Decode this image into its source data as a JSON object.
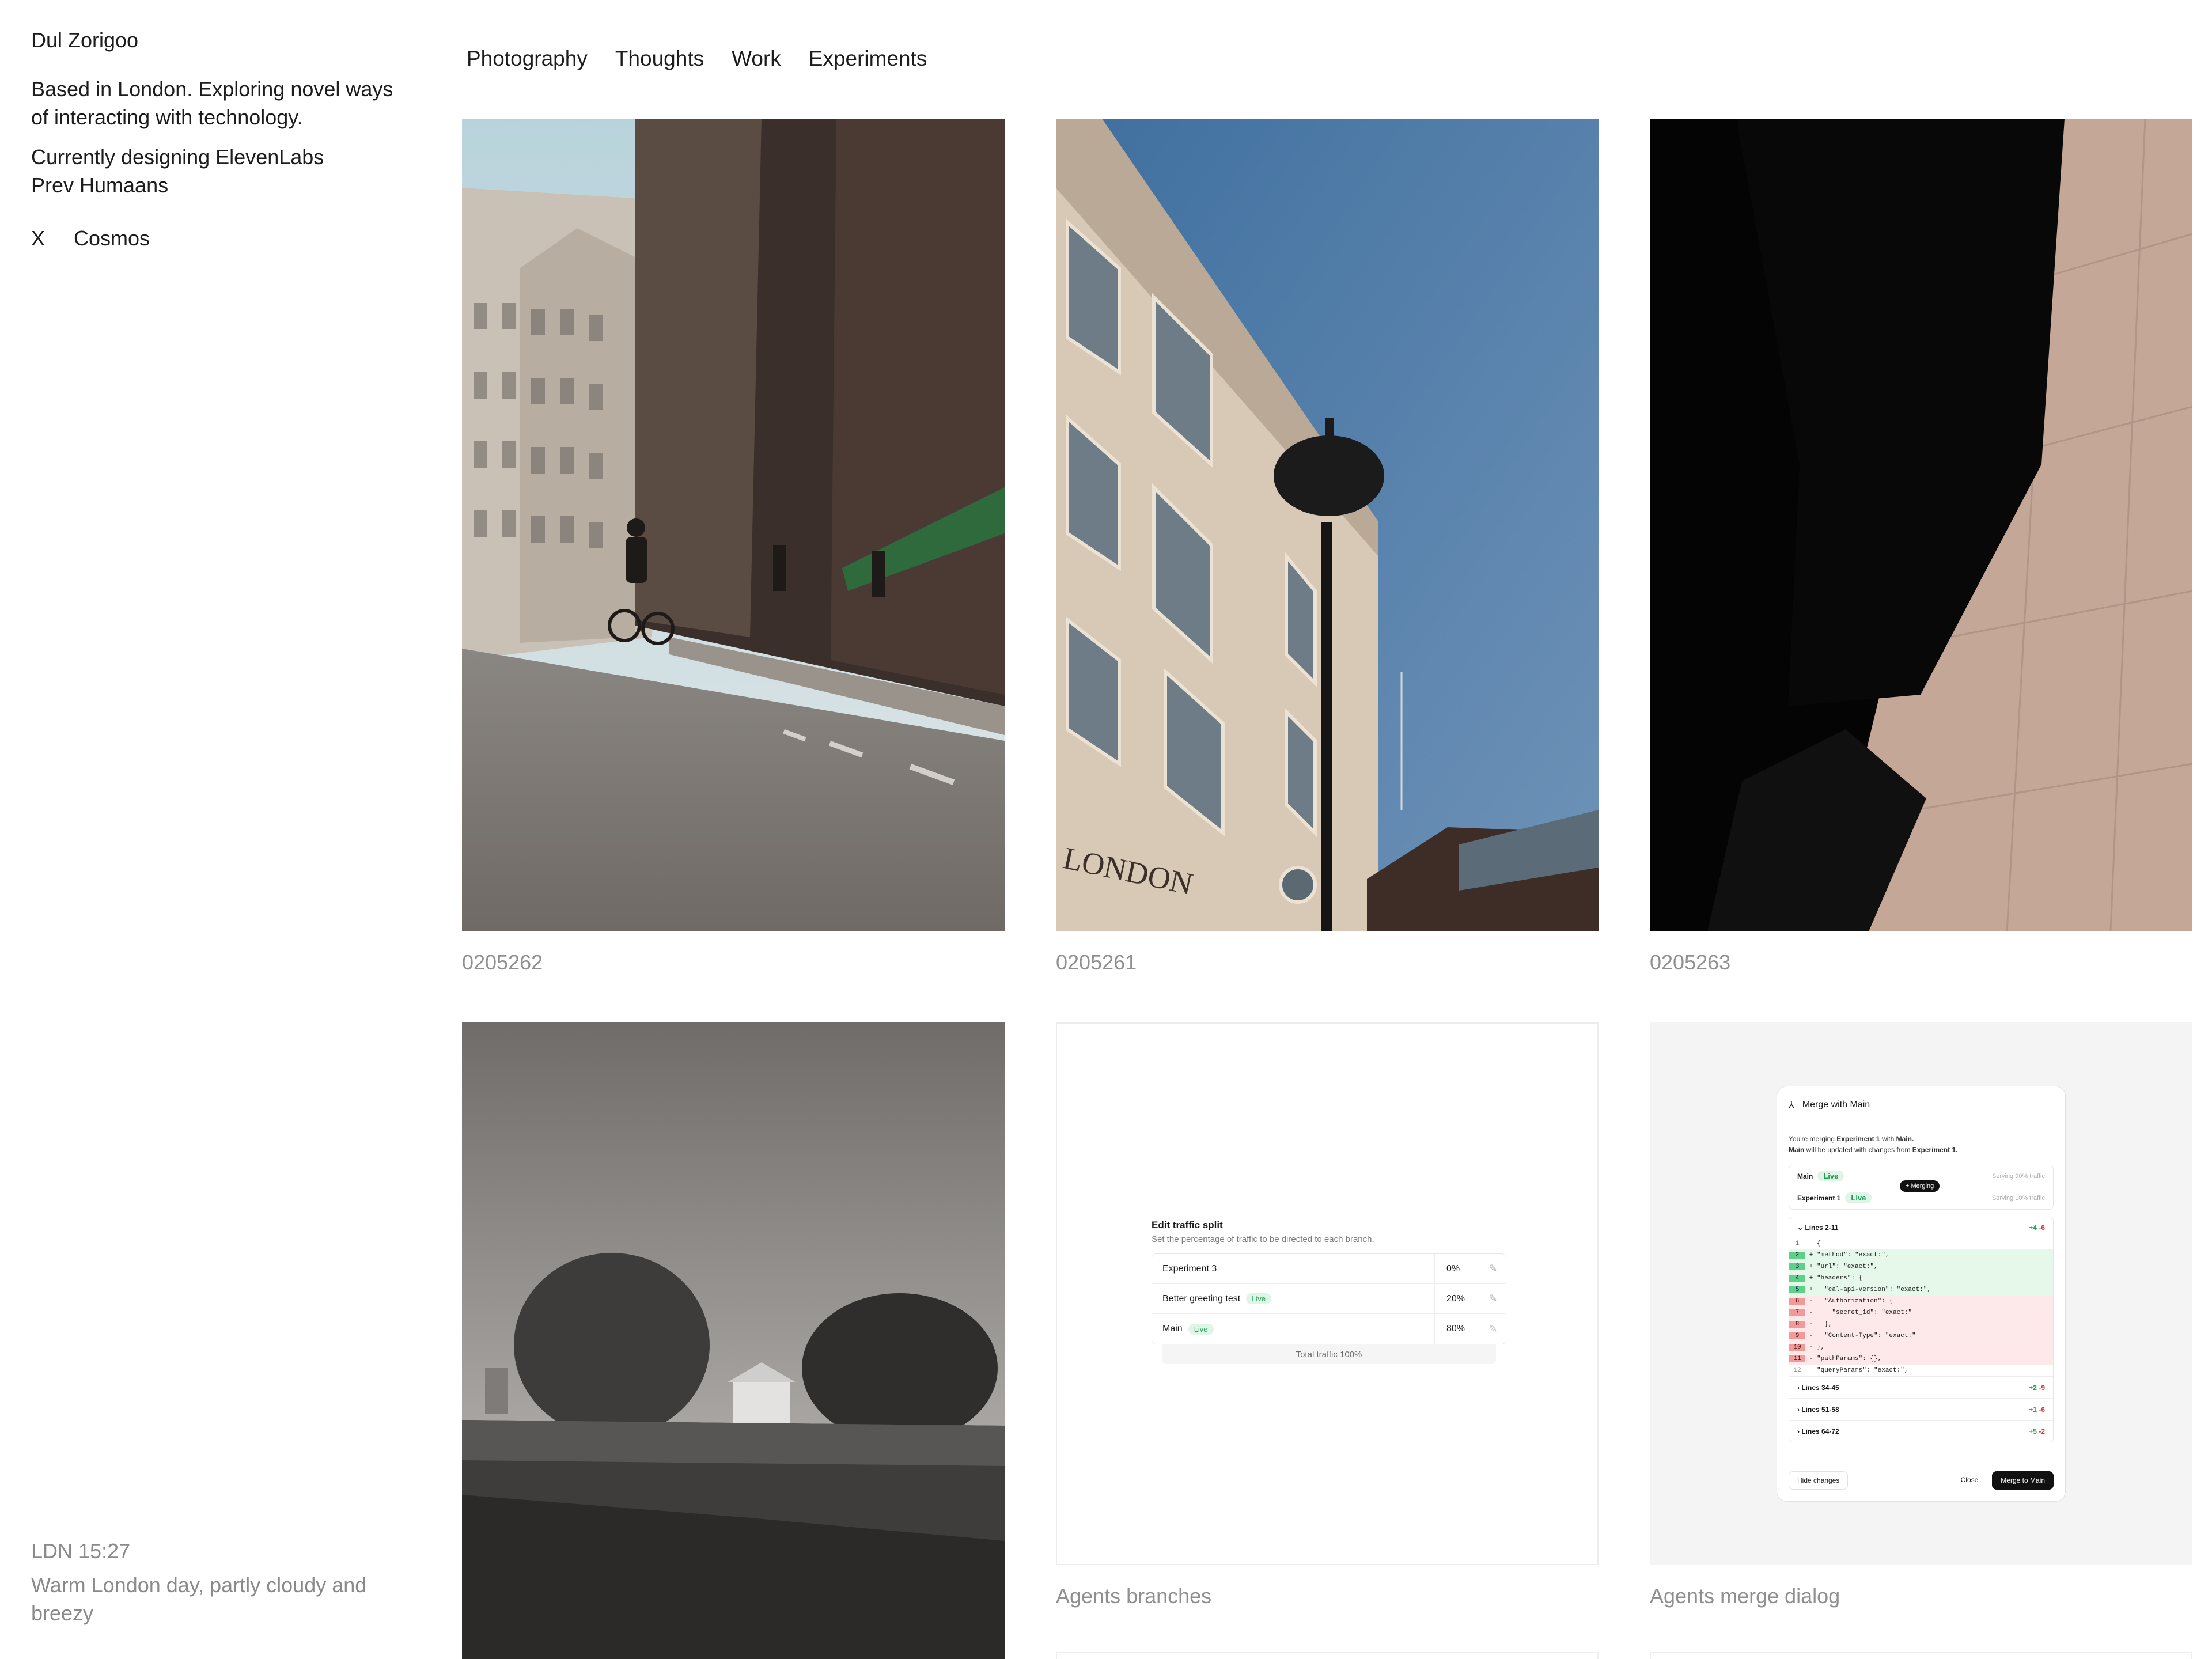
{
  "profile": {
    "name": "Dul Zorigoo",
    "bio": "Based in London. Exploring novel ways of interacting with technology.",
    "current": "Currently designing ElevenLabs",
    "previous": "Prev Humaans",
    "links": [
      "X",
      "Cosmos"
    ]
  },
  "nav": {
    "items": [
      "Photography",
      "Thoughts",
      "Work",
      "Experiments"
    ]
  },
  "grid": [
    {
      "caption": "0205262"
    },
    {
      "caption": "0205261"
    },
    {
      "caption": "0205263"
    },
    {
      "caption": ""
    },
    {
      "caption": "Agents branches"
    },
    {
      "caption": "Agents merge dialog"
    }
  ],
  "traffic_split": {
    "title": "Edit traffic split",
    "subtitle": "Set the percentage of traffic to be directed to each branch.",
    "rows": [
      {
        "name": "Experiment 3",
        "badge": "",
        "percent": "0%"
      },
      {
        "name": "Better greeting test",
        "badge": "Live",
        "percent": "20%"
      },
      {
        "name": "Main",
        "badge": "Live",
        "percent": "80%"
      }
    ],
    "total": "Total traffic 100%"
  },
  "merge_dialog": {
    "title": "Merge with Main",
    "desc_line1_a": "You're merging ",
    "desc_line1_b": "Experiment 1",
    "desc_line1_c": " with ",
    "desc_line1_d": "Main.",
    "desc_line2_a": "Main",
    "desc_line2_b": " will be updated with changes from ",
    "desc_line2_c": "Experiment 1.",
    "branches": [
      {
        "name": "Main",
        "badge": "Live",
        "traffic": "Serving 90% traffic"
      },
      {
        "name": "Experiment 1",
        "badge": "Live",
        "traffic": "Serving 10% traffic"
      }
    ],
    "merging_label": "+ Merging",
    "diff_header": "Lines 2-11",
    "diff_added": "+4",
    "diff_removed": "-6",
    "code_lines": [
      {
        "n": "1",
        "t": "ctx",
        "s": "",
        "c": "{"
      },
      {
        "n": "2",
        "t": "add",
        "s": "+",
        "c": "\"method\": \"exact:\","
      },
      {
        "n": "3",
        "t": "add",
        "s": "+",
        "c": "\"url\": \"exact:\","
      },
      {
        "n": "4",
        "t": "add",
        "s": "+",
        "c": "\"headers\": {"
      },
      {
        "n": "5",
        "t": "add",
        "s": "+",
        "c": "  \"cal-api-version\": \"exact:\","
      },
      {
        "n": "6",
        "t": "del",
        "s": "-",
        "c": "  \"Authorization\": {"
      },
      {
        "n": "7",
        "t": "del",
        "s": "-",
        "c": "    \"secret_id\": \"exact:\""
      },
      {
        "n": "8",
        "t": "del",
        "s": "-",
        "c": "  },"
      },
      {
        "n": "9",
        "t": "del",
        "s": "-",
        "c": "  \"Content-Type\": \"exact:\""
      },
      {
        "n": "10",
        "t": "del",
        "s": "-",
        "c": "},"
      },
      {
        "n": "11",
        "t": "del",
        "s": "-",
        "c": "\"pathParams\": {},"
      },
      {
        "n": "12",
        "t": "ctx",
        "s": "",
        "c": "\"queryParams\": \"exact:\","
      }
    ],
    "hunks": [
      {
        "label": "Lines 34-45",
        "plus": "+2",
        "minus": "-9"
      },
      {
        "label": "Lines 51-58",
        "plus": "+1",
        "minus": "-6"
      },
      {
        "label": "Lines 64-72",
        "plus": "+5",
        "minus": "-2"
      }
    ],
    "hide_label": "Hide changes",
    "close_label": "Close",
    "merge_label": "Merge to Main"
  },
  "footer": {
    "time": "LDN 15:27",
    "weather": "Warm London day, partly cloudy and breezy"
  },
  "colors": {
    "text": "#1c1c1c",
    "muted": "#8a8a8a",
    "live_bg": "#dff5e8",
    "live_fg": "#1f9d55",
    "diff_add": "#e5f8ea",
    "diff_del": "#fde9e9"
  }
}
